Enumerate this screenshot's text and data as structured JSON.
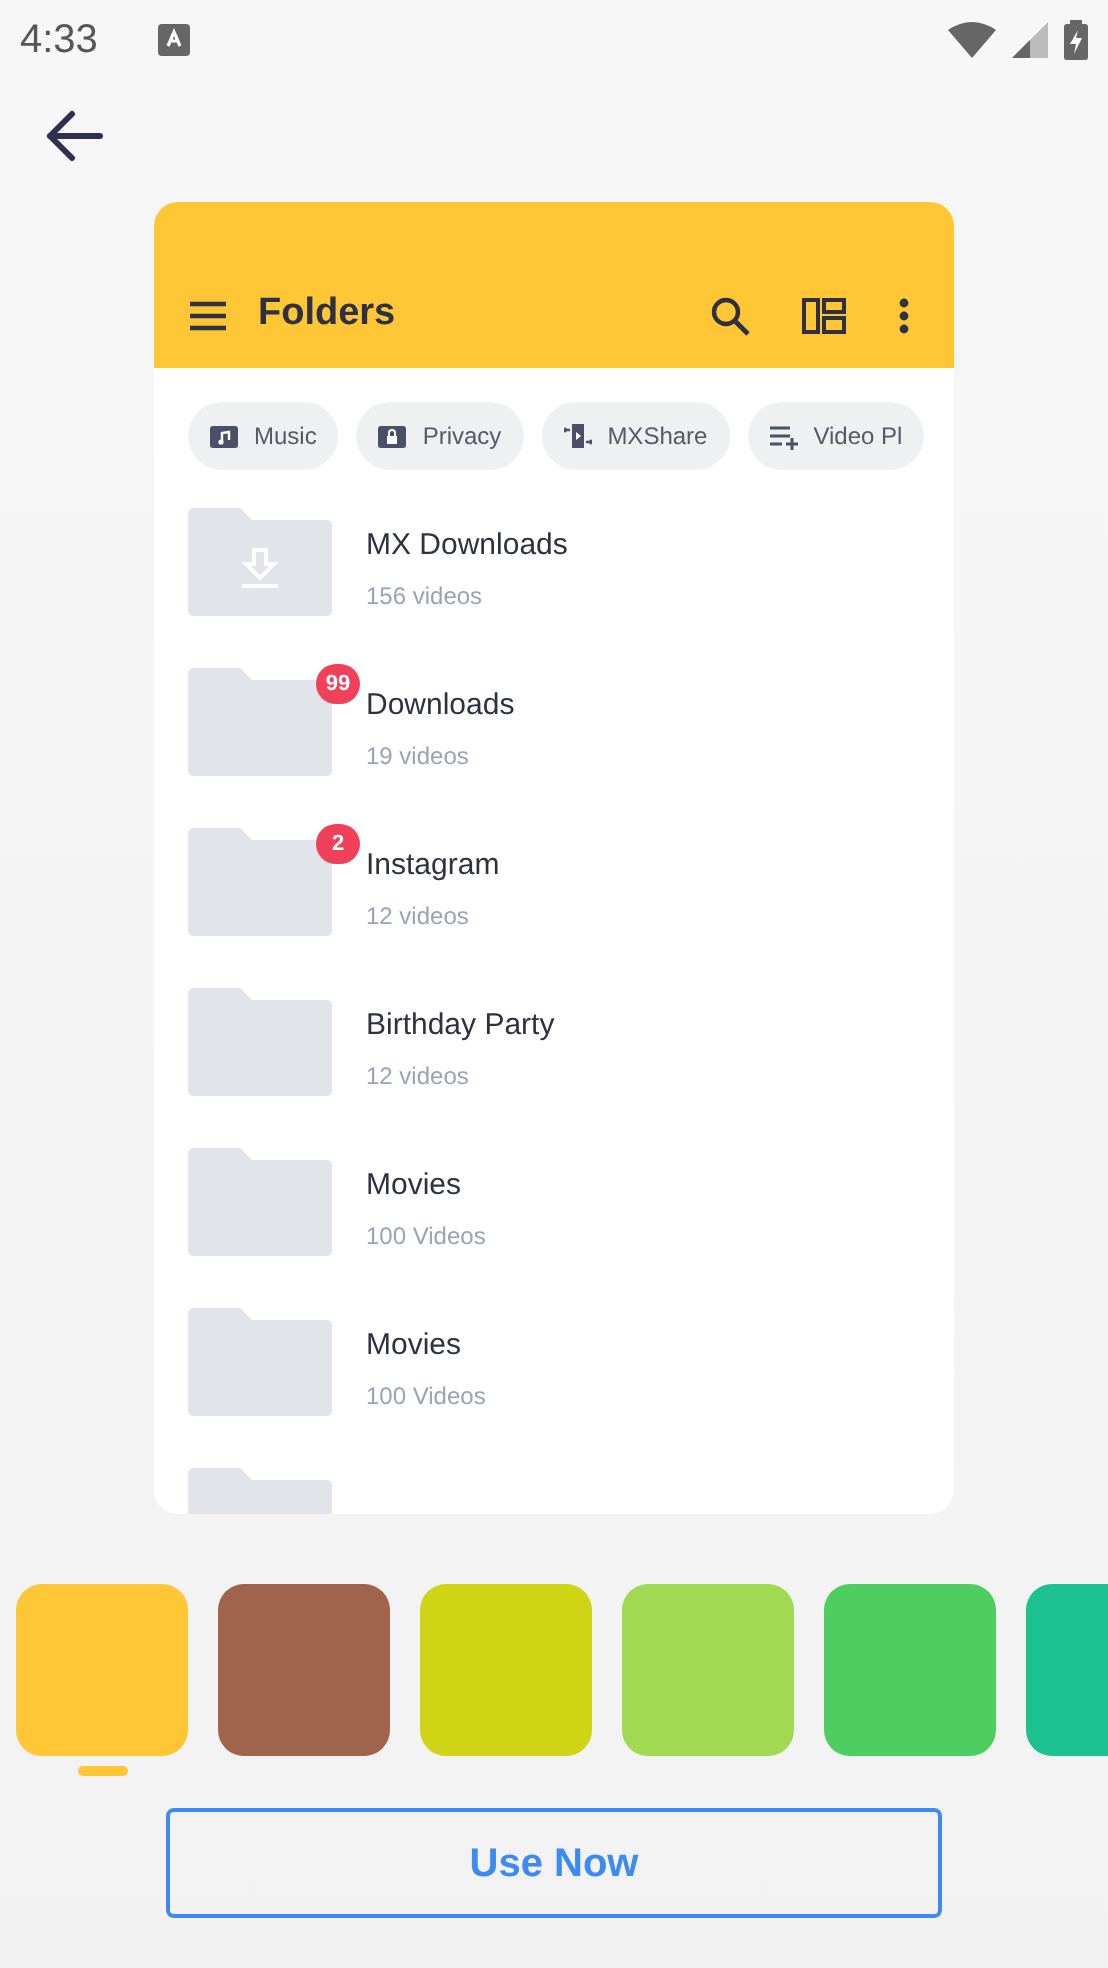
{
  "status_bar": {
    "time": "4:33"
  },
  "preview": {
    "app_bar": {
      "title": "Folders"
    },
    "chips": [
      {
        "label": "Music"
      },
      {
        "label": "Privacy"
      },
      {
        "label": "MXShare"
      },
      {
        "label": "Video Pl"
      }
    ],
    "folders": [
      {
        "kind": "download",
        "name": "MX Downloads",
        "count": "156 videos"
      },
      {
        "kind": "plain",
        "name": "Downloads",
        "count": "19 videos",
        "badge": "99"
      },
      {
        "kind": "plain",
        "name": "Instagram",
        "count": "12 videos",
        "badge": "2"
      },
      {
        "kind": "plain",
        "name": "Birthday Party",
        "count": "12 videos"
      },
      {
        "kind": "plain",
        "name": "Movies",
        "count": "100 Videos"
      },
      {
        "kind": "plain",
        "name": "Movies",
        "count": "100 Videos"
      },
      {
        "kind": "cut"
      }
    ]
  },
  "swatches": [
    {
      "color": "#ffc636",
      "selected": true
    },
    {
      "color": "#a0644c",
      "selected": false
    },
    {
      "color": "#cfd415",
      "selected": false
    },
    {
      "color": "#a1da52",
      "selected": false
    },
    {
      "color": "#4ecd60",
      "selected": false
    },
    {
      "color": "#1bc28f",
      "selected": false
    }
  ],
  "button": "Use Now"
}
